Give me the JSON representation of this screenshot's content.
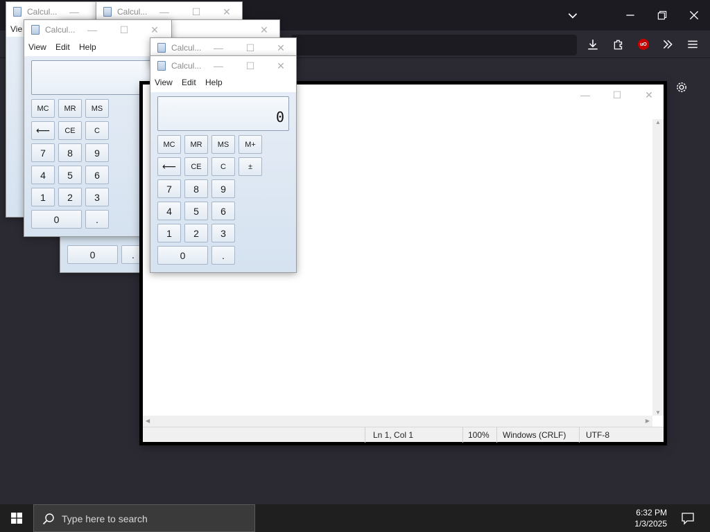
{
  "calculator": {
    "title": "Calcul...",
    "menu": [
      "View",
      "Edit",
      "Help"
    ],
    "display_value": "0",
    "memory_keys": [
      "MC",
      "MR",
      "MS",
      "M+"
    ],
    "edit_keys": [
      "⟵",
      "CE",
      "C",
      "±"
    ],
    "rows": [
      [
        "7",
        "8",
        "9"
      ],
      [
        "4",
        "5",
        "6"
      ],
      [
        "1",
        "2",
        "3"
      ]
    ],
    "zero": "0",
    "dot": ".",
    "back_title_fragment": "Vie"
  },
  "notepad": {
    "status": {
      "position": "Ln 1, Col 1",
      "zoom": "100%",
      "line_ending": "Windows (CRLF)",
      "encoding": "UTF-8"
    }
  },
  "taskbar": {
    "search_placeholder": "Type here to search",
    "time": "6:32 PM",
    "date": "1/3/2025"
  }
}
